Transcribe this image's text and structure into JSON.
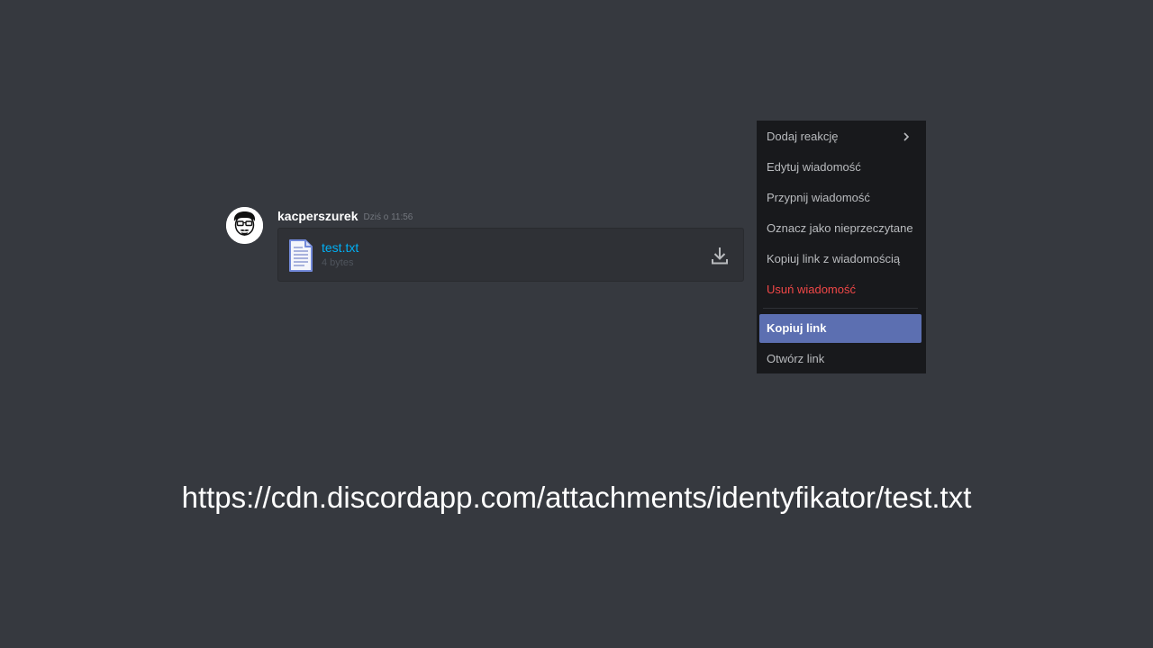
{
  "message": {
    "username": "kacperszurek",
    "timestamp": "Dziś o 11:56",
    "attachment": {
      "file_name": "test.txt",
      "file_size": "4 bytes",
      "file_icon": "text-file-icon",
      "download_icon": "download-icon"
    }
  },
  "context_menu": {
    "items": [
      {
        "label": "Dodaj reakcję",
        "submenu_icon": "chevron-right-icon"
      },
      {
        "label": "Edytuj wiadomość"
      },
      {
        "label": "Przypnij wiadomość"
      },
      {
        "label": "Oznacz jako nieprzeczytane"
      },
      {
        "label": "Kopiuj link z wiadomością"
      },
      {
        "label": "Usuń wiadomość",
        "style": "danger"
      },
      {
        "label": "Kopiuj link",
        "state": "focused"
      },
      {
        "label": "Otwórz link"
      }
    ]
  },
  "caption": {
    "url": "https://cdn.discordapp.com/attachments/identyfikator/test.txt"
  },
  "colors": {
    "background": "#36393f",
    "menu_background": "#18191c",
    "menu_highlight": "#5c6fb1",
    "danger": "#f04747",
    "link": "#00aff4"
  }
}
